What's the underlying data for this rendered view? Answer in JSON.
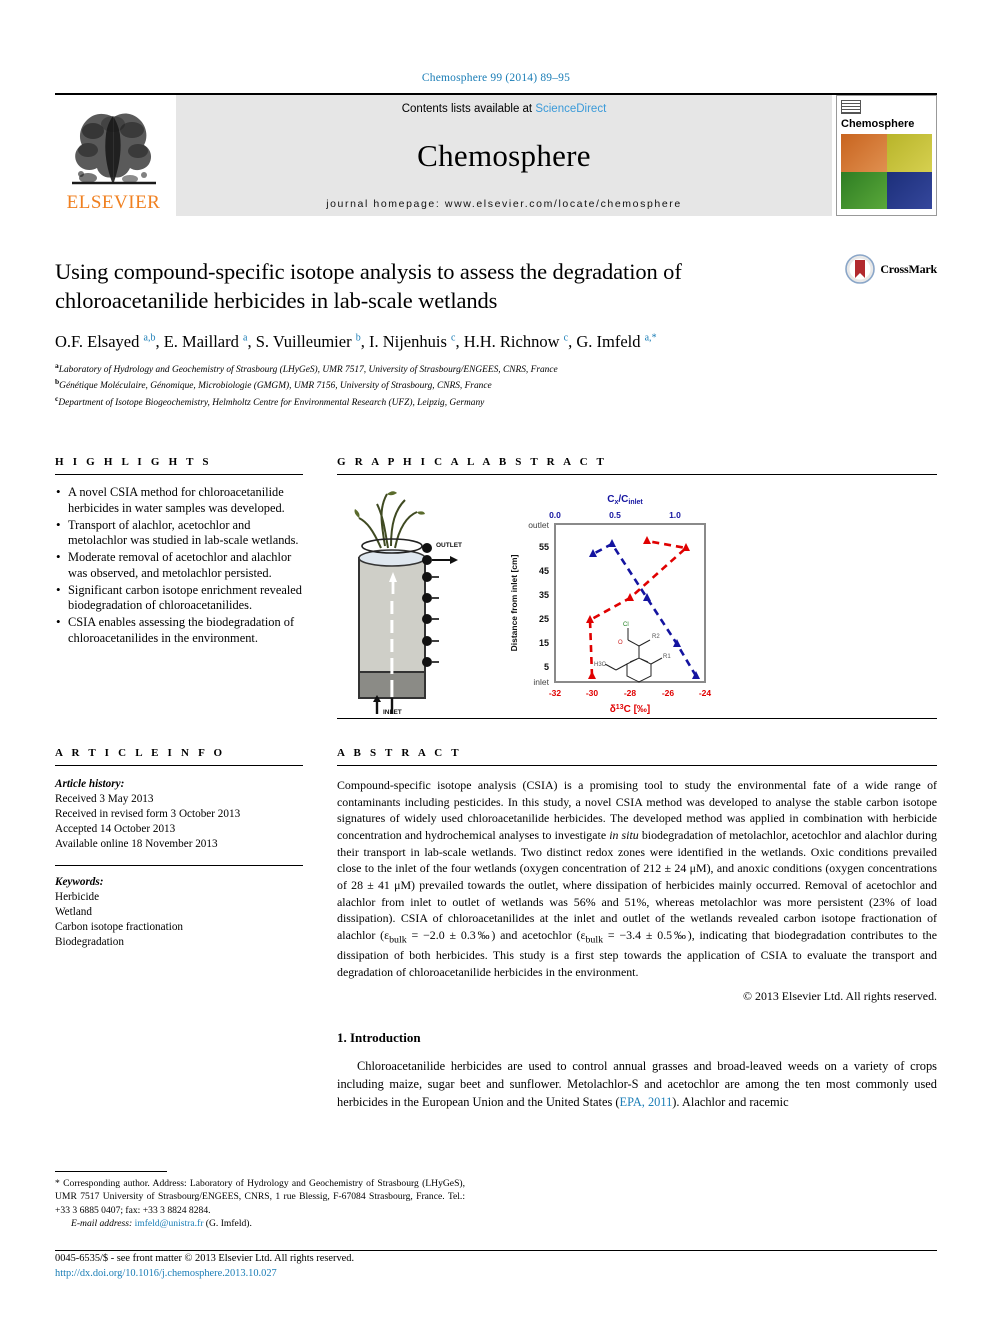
{
  "running_head": "Chemosphere 99 (2014) 89–95",
  "masthead": {
    "publisher": "ELSEVIER",
    "contents_prefix": "Contents lists available at ",
    "contents_link": "ScienceDirect",
    "journal_title": "Chemosphere",
    "homepage": "journal homepage: www.elsevier.com/locate/chemosphere",
    "cover_label": "Chemosphere"
  },
  "crossmark": {
    "label": "CrossMark"
  },
  "article": {
    "title": "Using compound-specific isotope analysis to assess the degradation of chloroacetanilide herbicides in lab-scale wetlands",
    "authors_html": "O.F. Elsayed <sup>a,b</sup>, E. Maillard <sup>a</sup>, S. Vuilleumier <sup>b</sup>, I. Nijenhuis <sup>c</sup>, H.H. Richnow <sup>c</sup>, G. Imfeld <sup>a,</sup><sup>*</sup>",
    "affiliations": [
      {
        "mark": "a",
        "text": "Laboratory of Hydrology and Geochemistry of Strasbourg (LHyGeS), UMR 7517, University of Strasbourg/ENGEES, CNRS, France"
      },
      {
        "mark": "b",
        "text": "Génétique Moléculaire, Génomique, Microbiologie (GMGM), UMR 7156, University of Strasbourg, CNRS, France"
      },
      {
        "mark": "c",
        "text": "Department of Isotope Biogeochemistry, Helmholtz Centre for Environmental Research (UFZ), Leipzig, Germany"
      }
    ]
  },
  "highlights": {
    "heading": "H I G H L I G H T S",
    "items": [
      "A novel CSIA method for chloroacetanilide herbicides in water samples was developed.",
      "Transport of alachlor, acetochlor and metolachlor was studied in lab-scale wetlands.",
      "Moderate removal of acetochlor and alachlor was observed, and metolachlor persisted.",
      "Significant carbon isotope enrichment revealed biodegradation of chloroacetanilides.",
      "CSIA enables assessing the biodegradation of chloroacetanilides in the environment."
    ]
  },
  "graphical_abstract": {
    "heading": "G R A P H I C A L   A B S T R A C T",
    "column_labels": {
      "outlet": "OUTLET",
      "inlet": "INLET"
    }
  },
  "chart_data": {
    "type": "line",
    "title": "",
    "xlabel": "δ13C [‰]",
    "xlabel_top": "Cx/Cinlet",
    "ylabel": "Distance from inlet [cm]",
    "ytick_labels": [
      "5",
      "15",
      "25",
      "35",
      "45",
      "55"
    ],
    "ytick_values": [
      5,
      15,
      25,
      35,
      45,
      55
    ],
    "y_end_labels": {
      "top": "outlet",
      "bottom": "inlet"
    },
    "xlim_bottom": [
      -32,
      -24
    ],
    "xtick_labels_bottom": [
      "-32",
      "-30",
      "-28",
      "-26",
      "-24"
    ],
    "xtick_values_bottom": [
      -32,
      -30,
      -28,
      -26,
      -24
    ],
    "xlim_top": [
      0.0,
      1.25
    ],
    "xtick_labels_top": [
      "0.0",
      "0.5",
      "1.0"
    ],
    "xtick_values_top": [
      0.0,
      0.5,
      1.0
    ],
    "grid": false,
    "legend_position": "none",
    "series": [
      {
        "name": "δ13C [‰]",
        "color": "#e00000",
        "axis": "bottom",
        "style": "dashed-triangle",
        "points": [
          {
            "x": -30.0,
            "y": 0
          },
          {
            "x": -30.2,
            "y": 25
          },
          {
            "x": -28.0,
            "y": 35
          },
          {
            "x": -25.1,
            "y": 55
          },
          {
            "x": -27.3,
            "y": 62
          }
        ]
      },
      {
        "name": "Cx/Cinlet",
        "color": "#1414a0",
        "axis": "top",
        "style": "dashed-triangle",
        "points": [
          {
            "x": 1.02,
            "y": 0
          },
          {
            "x": 0.93,
            "y": 22
          },
          {
            "x": 0.7,
            "y": 35
          },
          {
            "x": 0.33,
            "y": 55
          },
          {
            "x": 0.47,
            "y": 62
          }
        ]
      }
    ],
    "annotation": "chloroacetanilide molecular structure"
  },
  "article_info": {
    "heading": "A R T I C L E   I N F O",
    "history_label": "Article history:",
    "history": [
      "Received 3 May 2013",
      "Received in revised form 3 October 2013",
      "Accepted 14 October 2013",
      "Available online 18 November 2013"
    ],
    "keywords_label": "Keywords:",
    "keywords": [
      "Herbicide",
      "Wetland",
      "Carbon isotope fractionation",
      "Biodegradation"
    ]
  },
  "abstract": {
    "heading": "A B S T R A C T",
    "body_html": "Compound-specific isotope analysis (CSIA) is a promising tool to study the environmental fate of a wide range of contaminants including pesticides. In this study, a novel CSIA method was developed to analyse the stable carbon isotope signatures of widely used chloroacetanilide herbicides. The developed method was applied in combination with herbicide concentration and hydrochemical analyses to investigate <i>in situ</i> biodegradation of metolachlor, acetochlor and alachlor during their transport in lab-scale wetlands. Two distinct redox zones were identified in the wetlands. Oxic conditions prevailed close to the inlet of the four wetlands (oxygen concentration of 212 ± 24 μM), and anoxic conditions (oxygen concentrations of 28 ± 41 μM) prevailed towards the outlet, where dissipation of herbicides mainly occurred. Removal of acetochlor and alachlor from inlet to outlet of wetlands was 56% and 51%, whereas metolachlor was more persistent (23% of load dissipation). CSIA of chloroacetanilides at the inlet and outlet of the wetlands revealed carbon isotope fractionation of alachlor (ε<sub>bulk</sub> = −2.0 ± 0.3‰) and acetochlor (ε<sub>bulk</sub> = −3.4 ± 0.5‰), indicating that biodegradation contributes to the dissipation of both herbicides. This study is a first step towards the application of CSIA to evaluate the transport and degradation of chloroacetanilide herbicides in the environment.",
    "copyright": "© 2013 Elsevier Ltd. All rights reserved."
  },
  "introduction": {
    "heading": "1. Introduction",
    "paragraph_html": "Chloroacetanilide herbicides are used to control annual grasses and broad-leaved weeds on a variety of crops including maize, sugar beet and sunflower. Metolachlor-S and acetochlor are among the ten most commonly used herbicides in the European Union and the United States (<span class=\"lnk\">EPA, 2011</span>). Alachlor and racemic"
  },
  "footnote": {
    "corresponding_html": "* Corresponding author. Address: Laboratory of Hydrology and Geochemistry of Strasbourg (LHyGeS), UMR 7517 University of Strasbourg/ENGEES, CNRS, 1 rue Blessig, F-67084 Strasbourg, France. Tel.: +33 3 6885 0407; fax: +33 3 8824 8284.",
    "email_html": "<span class=\"em\">E-mail address:</span> <span class=\"lnk\">imfeld@unistra.fr</span> (G. Imfeld)."
  },
  "bottom": {
    "issn_line": "0045-6535/$ - see front matter © 2013 Elsevier Ltd. All rights reserved.",
    "doi": "http://dx.doi.org/10.1016/j.chemosphere.2013.10.027"
  },
  "colors": {
    "link_blue": "#1a7db6",
    "elsevier_orange": "#f08020",
    "series_red": "#e00000",
    "series_blue": "#1414a0",
    "band_grey": "#e6e6e6"
  }
}
